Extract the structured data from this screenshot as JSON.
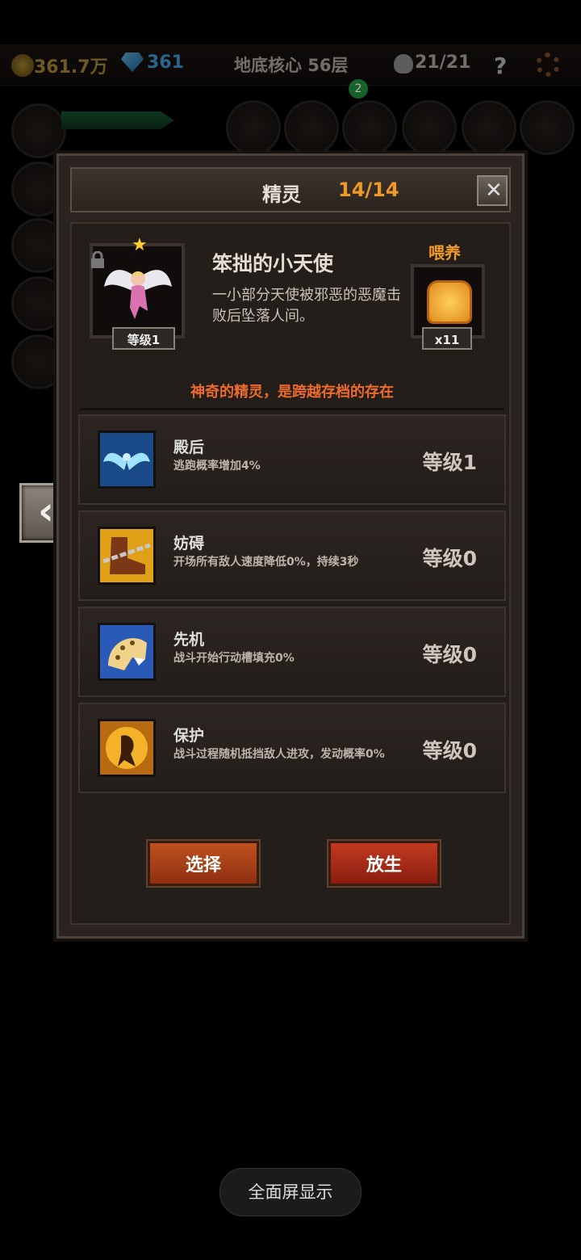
{
  "status_bar": {
    "gold": "361.7万",
    "gems": "361",
    "location": "地底核心 56层",
    "kills": "21/21",
    "help": "?"
  },
  "notification_badge": "2",
  "dialog": {
    "title": "精灵",
    "count": "14/14",
    "close": "✕",
    "spirit": {
      "name": "笨拙的小天使",
      "description": "一小部分天使被邪恶的恶魔击败后坠落人间。",
      "level": "等级1",
      "feed_label": "喂养",
      "feed_count": "x11",
      "flavor": "神奇的精灵，是跨越存档的存在"
    },
    "skills": [
      {
        "name": "殿后",
        "desc": "逃跑概率增加4%",
        "level": "等级1",
        "icon": "wings-icon"
      },
      {
        "name": "妨碍",
        "desc": "开场所有敌人速度降低0%，持续3秒",
        "level": "等级0",
        "icon": "chained-boot-icon"
      },
      {
        "name": "先机",
        "desc": "战斗开始行动槽填充0%",
        "level": "等级0",
        "icon": "leopard-icon"
      },
      {
        "name": "保护",
        "desc": "战斗过程随机抵挡敌人进攻，发动概率0%",
        "level": "等级0",
        "icon": "shield-figure-icon"
      }
    ],
    "buttons": {
      "select": "选择",
      "release": "放生"
    }
  },
  "back_arrow": "‹",
  "toast": "全面屏显示",
  "colors": {
    "accent": "#f09a25",
    "flavor": "#ec6a2c",
    "button": "#b0441a"
  }
}
